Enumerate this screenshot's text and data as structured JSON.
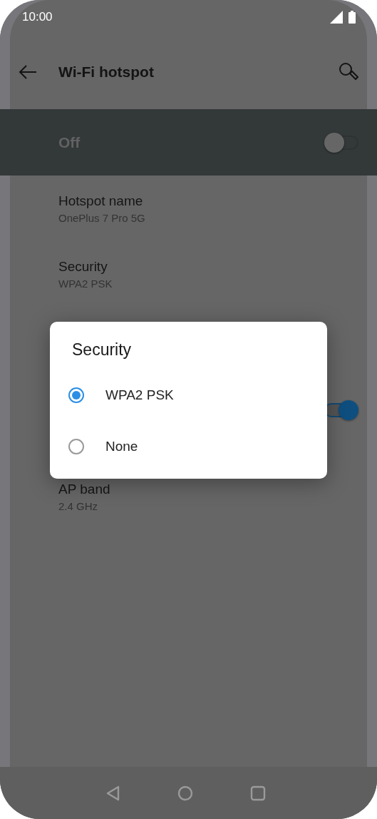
{
  "status_bar": {
    "time": "10:00"
  },
  "toolbar": {
    "title": "Wi-Fi hotspot"
  },
  "master_switch": {
    "label": "Off",
    "on": false
  },
  "settings": [
    {
      "kind": "text",
      "title": "Hotspot name",
      "subtitle": "OnePlus 7 Pro 5G"
    },
    {
      "kind": "text",
      "title": "Security",
      "subtitle": "WPA2 PSK"
    },
    {
      "kind": "toggle",
      "on": true
    },
    {
      "kind": "text",
      "title": "AP band",
      "subtitle": "2.4 GHz"
    }
  ],
  "dialog": {
    "title": "Security",
    "options": [
      {
        "label": "WPA2 PSK",
        "selected": true
      },
      {
        "label": "None",
        "selected": false
      }
    ]
  }
}
